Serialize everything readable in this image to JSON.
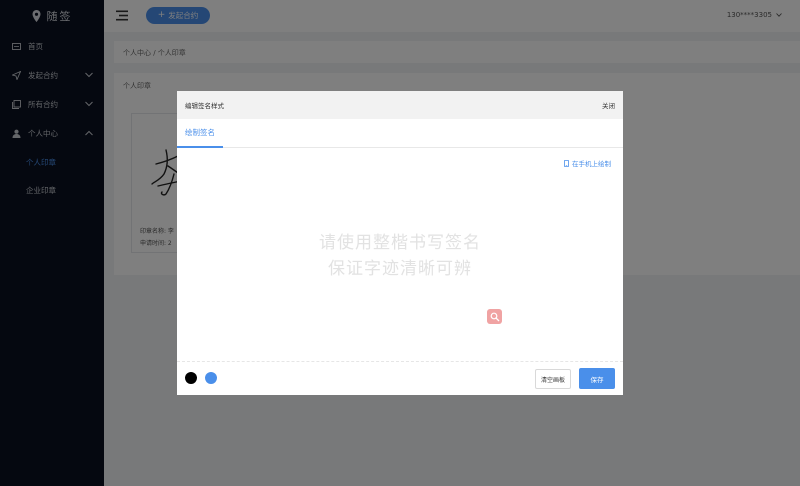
{
  "app": {
    "logo_text": "随签"
  },
  "sidebar": {
    "items": [
      {
        "label": "首页",
        "icon": "home-icon"
      },
      {
        "label": "发起合约",
        "icon": "send-icon"
      },
      {
        "label": "所有合约",
        "icon": "documents-icon"
      },
      {
        "label": "个人中心",
        "icon": "user-icon"
      }
    ],
    "sub_items": [
      {
        "label": "个人印章",
        "active": true
      },
      {
        "label": "企业印章",
        "active": false
      }
    ]
  },
  "topbar": {
    "start_button": "发起合约",
    "user_phone": "130****3305"
  },
  "breadcrumb": "个人中心 / 个人印章",
  "seal_section": {
    "title": "个人印章",
    "card": {
      "name_label": "印章名称: 李",
      "date_label": "申请时间: 2"
    }
  },
  "modal": {
    "title": "编辑签名样式",
    "close_label": "关闭",
    "tab_label": "绘制签名",
    "phone_link": "在手机上绘制",
    "hint_line1": "请使用整楷书写签名",
    "hint_line2": "保证字迹清晰可辨",
    "clear_button": "清空画板",
    "save_button": "保存",
    "pen_colors": [
      "#000000",
      "#4a8fea"
    ]
  },
  "colors": {
    "accent": "#4a8fea",
    "sidebar_bg": "#0a1020"
  }
}
